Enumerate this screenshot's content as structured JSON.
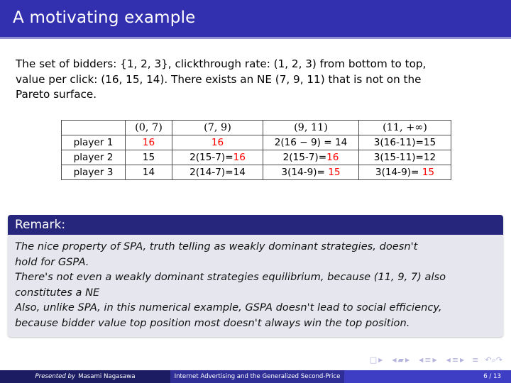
{
  "slide": {
    "title": "A motivating example",
    "intro_lines": [
      "The set of bidders: {1, 2, 3}, clickthrough rate: (1, 2, 3) from bottom to top,",
      "value per click: (16, 15, 14).  There exists an NE (7, 9, 11) that is not on the",
      "Pareto surface."
    ]
  },
  "table": {
    "columns": [
      "",
      "(0, 7)",
      "(7, 9)",
      "(9, 11)",
      "(11, +∞)"
    ],
    "rows": [
      {
        "label": "player 1",
        "cells": [
          {
            "text": "16",
            "red": true
          },
          {
            "text": "16",
            "red": true
          },
          {
            "text": "2(16 − 9) = 14",
            "red": false
          },
          {
            "text": "3(16-11)=15",
            "red": false
          }
        ]
      },
      {
        "label": "player 2",
        "cells": [
          {
            "text": "15",
            "red": false
          },
          {
            "pre": "2(15-7)=",
            "num": "16",
            "red": true
          },
          {
            "pre": "2(15-7)=",
            "num": "16",
            "red": true
          },
          {
            "text": "3(15-11)=12",
            "red": false
          }
        ]
      },
      {
        "label": "player 3",
        "cells": [
          {
            "text": "14",
            "red": false
          },
          {
            "text": "2(14-7)=14",
            "red": false
          },
          {
            "pre": "3(14-9)= ",
            "num": "15",
            "red": true
          },
          {
            "pre": "3(14-9)= ",
            "num": "15",
            "red": true
          }
        ]
      }
    ]
  },
  "remark": {
    "header": "Remark:",
    "lines": [
      "The nice property of SPA, truth telling as weakly dominant strategies, doesn't",
      "hold for GSPA.",
      "There's not even a weakly dominant strategies equilibrium, because (11, 9, 7) also",
      "constitutes a NE",
      "Also, unlike SPA, in this numerical example, GSPA doesn't lead to social efficiency,",
      "because bidder value top position most doesn't always win the top position."
    ]
  },
  "navigation": {
    "first_slide": "□",
    "prev_slide": "◀",
    "next_slide": "▶",
    "back_frame": "▰",
    "sections": "≡",
    "back_icon": "↶",
    "search_icon": "⌕",
    "forward_icon": "↷"
  },
  "footer": {
    "presented_by": "Presented by",
    "author": "Masami Nagasawa",
    "talk_title": "Internet Advertising and the Generalized Second-Price",
    "page": "6 / 13"
  },
  "colors": {
    "title_bar": "#3330af",
    "remark_header": "#26267c",
    "remark_body": "#e6e6ef",
    "highlight_red": "#ff0000",
    "footer_author": "#1c1c63",
    "footer_title": "#2e2e96",
    "footer_page": "#3e3ec4"
  }
}
